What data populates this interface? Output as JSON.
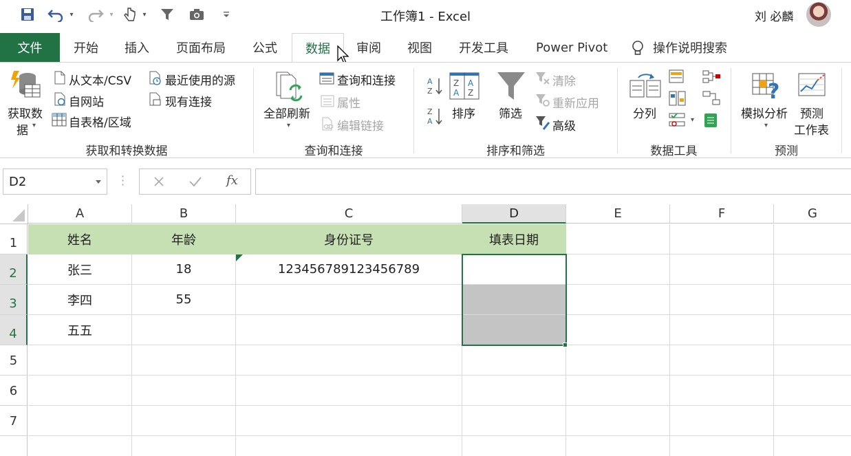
{
  "window": {
    "title": "工作簿1  -  Excel",
    "user": "刘 必麟"
  },
  "tabs": [
    "文件",
    "开始",
    "插入",
    "页面布局",
    "公式",
    "数据",
    "审阅",
    "视图",
    "开发工具",
    "Power Pivot"
  ],
  "active_tab": "数据",
  "tell_me": "操作说明搜索",
  "ribbon": {
    "get_transform": {
      "label": "获取和转换数据",
      "get_data": [
        "获取数",
        "据"
      ],
      "from_text_csv": "从文本/CSV",
      "from_web": "自网站",
      "from_table": "自表格/区域",
      "recent_sources": "最近使用的源",
      "existing_connections": "现有连接"
    },
    "queries": {
      "label": "查询和连接",
      "refresh_all": "全部刷新",
      "queries_connections": "查询和连接",
      "properties": "属性",
      "edit_links": "编辑链接"
    },
    "sort_filter": {
      "label": "排序和筛选",
      "sort": "排序",
      "filter": "筛选",
      "clear": "清除",
      "reapply": "重新应用",
      "advanced": "高级"
    },
    "data_tools": {
      "label": "数据工具",
      "text_to_columns": "分列"
    },
    "forecast": {
      "label": "预测",
      "what_if": "模拟分析",
      "forecast_sheet": [
        "预测",
        "工作表"
      ]
    }
  },
  "formula_bar": {
    "name_box": "D2",
    "formula": ""
  },
  "columns": [
    "A",
    "B",
    "C",
    "D",
    "E",
    "F",
    "G"
  ],
  "rows": [
    "1",
    "2",
    "3",
    "4",
    "5",
    "6",
    "7"
  ],
  "sheet": {
    "row1": [
      "姓名",
      "年龄",
      "身份证号",
      "填表日期"
    ],
    "row2": [
      "张三",
      "18",
      "123456789123456789",
      ""
    ],
    "row3": [
      "李四",
      "55",
      "",
      ""
    ],
    "row4": [
      "五五",
      "",
      "",
      ""
    ]
  },
  "colors": {
    "excel_green": "#217346",
    "header_fill": "#c6e0b4",
    "selection_gray": "#c4c4c4"
  }
}
